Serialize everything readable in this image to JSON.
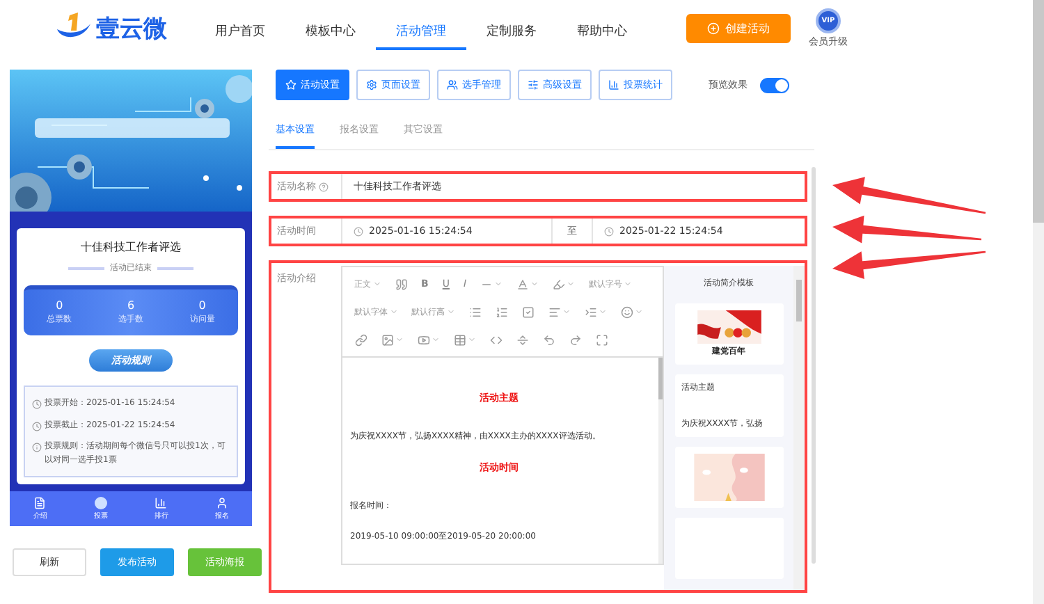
{
  "header": {
    "logo": "壹云微",
    "nav": [
      {
        "label": "用户首页",
        "selected": false
      },
      {
        "label": "模板中心",
        "selected": false
      },
      {
        "label": "活动管理",
        "selected": true
      },
      {
        "label": "定制服务",
        "selected": false
      },
      {
        "label": "帮助中心",
        "selected": false
      }
    ],
    "create_button": "创建活动",
    "vip_badge": "VIP",
    "upgrade": "会员升级"
  },
  "preview": {
    "card_title": "十佳科技工作者评选",
    "status": "活动已结束",
    "stats": [
      {
        "value": "0",
        "label": "总票数"
      },
      {
        "value": "6",
        "label": "选手数"
      },
      {
        "value": "0",
        "label": "访问量"
      }
    ],
    "rules_title": "活动规则",
    "rules": [
      {
        "kind": "clock",
        "label": "投票开始：",
        "value": "2025-01-16 15:24:54"
      },
      {
        "kind": "clock",
        "label": "投票截止：",
        "value": "2025-01-22 15:24:54"
      },
      {
        "kind": "info",
        "label": "投票规则：",
        "value": "活动期间每个微信号只可以投1次，可以对同一选手投1票"
      }
    ],
    "bottom_nav": [
      "介绍",
      "投票",
      "排行",
      "报名"
    ],
    "buttons": [
      {
        "label": "刷新",
        "kind": "plain"
      },
      {
        "label": "发布活动",
        "kind": "primary"
      },
      {
        "label": "活动海报",
        "kind": "success"
      }
    ]
  },
  "toolbar": [
    {
      "label": "活动设置",
      "selected": true
    },
    {
      "label": "页面设置",
      "selected": false
    },
    {
      "label": "选手管理",
      "selected": false
    },
    {
      "label": "高级设置",
      "selected": false
    },
    {
      "label": "投票统计",
      "selected": false
    }
  ],
  "preview_toggle": {
    "label": "预览效果",
    "on": true
  },
  "subtabs": [
    {
      "label": "基本设置",
      "selected": true
    },
    {
      "label": "报名设置",
      "selected": false
    },
    {
      "label": "其它设置",
      "selected": false
    }
  ],
  "form": {
    "name": {
      "label": "活动名称",
      "value": "十佳科技工作者评选",
      "highlighted": true
    },
    "time": {
      "label": "活动时间",
      "start": "2025-01-16 15:24:54",
      "separator": "至",
      "end": "2025-01-22 15:24:54",
      "highlighted": true
    },
    "intro": {
      "label": "活动介绍",
      "highlighted": true,
      "toolbar_labels": [
        "正文",
        "B",
        "U",
        "I",
        "默认字号",
        "默认字体",
        "默认行高"
      ],
      "content": [
        {
          "kind": "heading",
          "text": "活动主题"
        },
        {
          "kind": "text",
          "text": "为庆祝XXXX节，弘扬XXXX精神，由XXXX主办的XXXX评选活动。"
        },
        {
          "kind": "heading",
          "text": "活动时间"
        },
        {
          "kind": "text",
          "text": "报名时间："
        },
        {
          "kind": "text",
          "text": "2019-05-10 09:00:00至2019-05-20 20:00:00"
        }
      ],
      "templates": {
        "title": "活动简介模板",
        "cards": [
          {
            "kind": "picture",
            "caption": "建党百年"
          },
          {
            "kind": "text",
            "lines": [
              "活动主题",
              "为庆祝XXXX节，弘扬"
            ]
          },
          {
            "kind": "picture"
          },
          {
            "kind": "blank"
          }
        ]
      }
    }
  }
}
